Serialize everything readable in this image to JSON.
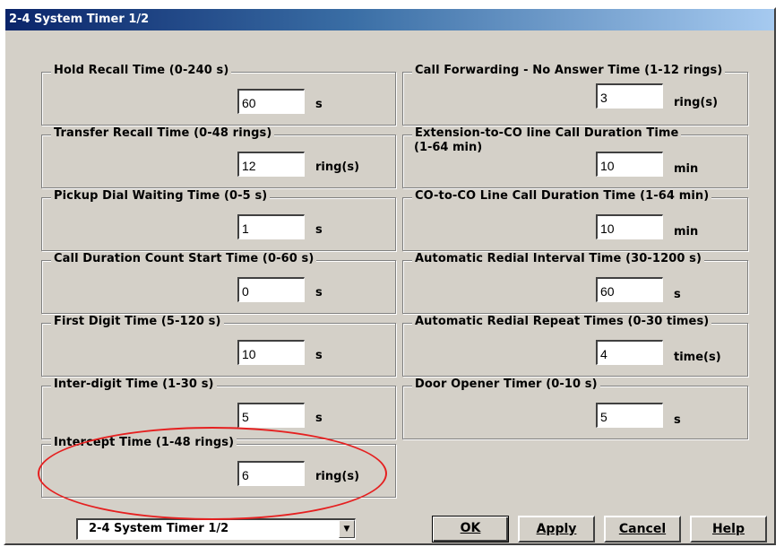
{
  "window": {
    "title": "2-4 System Timer 1/2"
  },
  "left_groups": [
    {
      "label": "Hold Recall Time (0-240 s)",
      "value": "60",
      "unit": "s"
    },
    {
      "label": "Transfer Recall Time (0-48 rings)",
      "value": "12",
      "unit": "ring(s)"
    },
    {
      "label": "Pickup Dial Waiting Time (0-5 s)",
      "value": "1",
      "unit": "s"
    },
    {
      "label": "Call Duration Count Start Time (0-60 s)",
      "value": "0",
      "unit": "s"
    },
    {
      "label": "First Digit Time (5-120 s)",
      "value": "10",
      "unit": "s"
    },
    {
      "label": "Inter-digit Time (1-30 s)",
      "value": "5",
      "unit": "s"
    },
    {
      "label": "Intercept Time (1-48 rings)",
      "value": "6",
      "unit": "ring(s)"
    }
  ],
  "right_groups": [
    {
      "label": "Call Forwarding - No Answer Time (1-12 rings)",
      "value": "3",
      "unit": "ring(s)"
    },
    {
      "label": "Extension-to-CO line Call Duration Time",
      "label2": "(1-64 min)",
      "value": "10",
      "unit": "min"
    },
    {
      "label": "CO-to-CO Line Call Duration Time (1-64 min)",
      "value": "10",
      "unit": "min"
    },
    {
      "label": "Automatic Redial Interval Time (30-1200 s)",
      "value": "60",
      "unit": "s"
    },
    {
      "label": "Automatic Redial Repeat Times (0-30 times)",
      "value": "4",
      "unit": "time(s)"
    },
    {
      "label": "Door Opener Timer (0-10 s)",
      "value": "5",
      "unit": "s"
    }
  ],
  "page_select": {
    "value": "2-4 System Timer 1/2",
    "arrow_icon": "combo-arrow-icon"
  },
  "buttons": {
    "ok": "OK",
    "apply": "Apply",
    "cancel": "Cancel",
    "help": "Help"
  },
  "colors": {
    "dialog_bg": "#d4d0c8",
    "titlebar": "#0a246a",
    "highlight_ellipse": "#e52020"
  }
}
